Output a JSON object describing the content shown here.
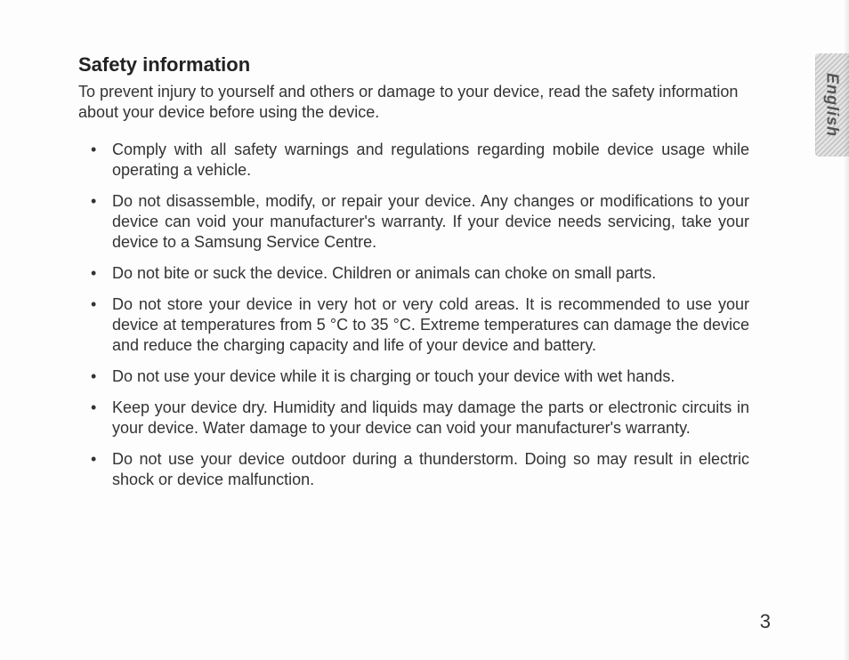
{
  "language_tab": "English",
  "page_number": "3",
  "heading": "Safety information",
  "intro": "To prevent injury to yourself and others or damage to your device, read the safety information about your device before using the device.",
  "bullets": [
    "Comply with all safety warnings and regulations regarding mobile device usage while operating a vehicle.",
    "Do not disassemble, modify, or repair your device. Any changes or modifications to your device can void your manufacturer's warranty. If your device needs servicing, take your device to a Samsung Service Centre.",
    "Do not bite or suck the device. Children or animals can choke on small parts.",
    "Do not store your device in very hot or very cold areas. It is recommended to use your device at temperatures from 5 °C to 35 °C. Extreme temperatures can damage the device and reduce the charging capacity and life of your device and battery.",
    "Do not use your device while it is charging or touch your device with wet hands.",
    "Keep your device dry. Humidity and liquids may damage the parts or electronic circuits in your device. Water damage to your device can void your manufacturer's warranty.",
    "Do not use your device outdoor during a thunderstorm. Doing so may result in electric shock or device malfunction."
  ]
}
